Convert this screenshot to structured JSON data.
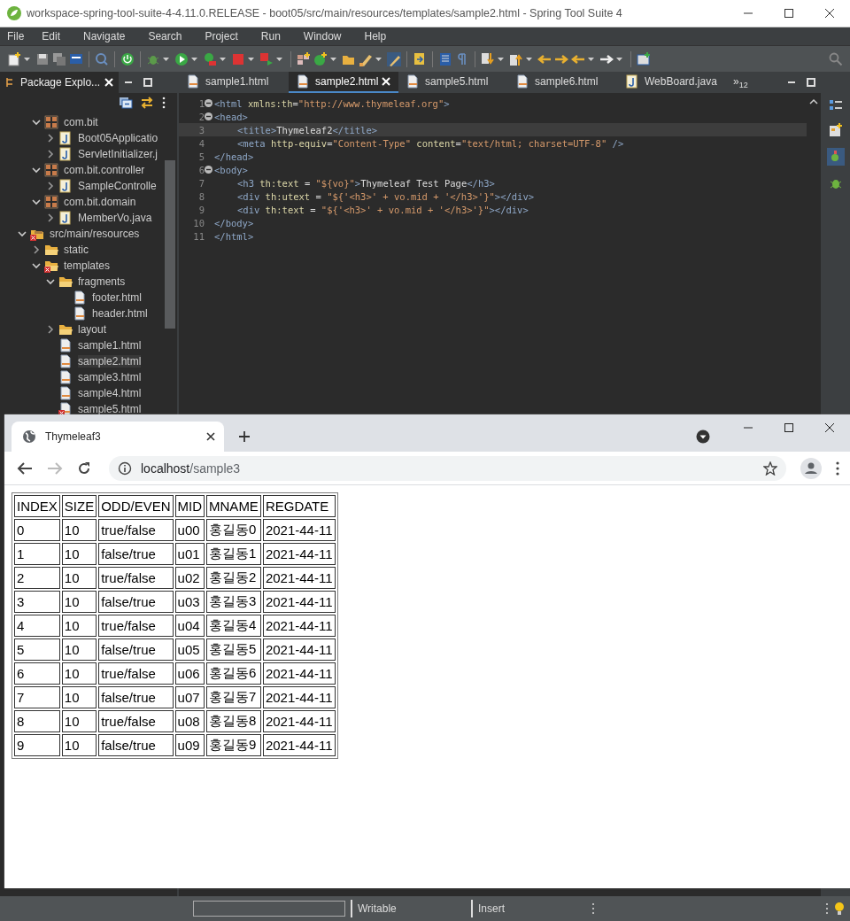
{
  "window": {
    "title": "workspace-spring-tool-suite-4-4.11.0.RELEASE - boot05/src/main/resources/templates/sample2.html - Spring Tool Suite 4"
  },
  "menu": [
    "File",
    "Edit",
    "Navigate",
    "Search",
    "Project",
    "Run",
    "Window",
    "Help"
  ],
  "explorer": {
    "tab": "Package Explo...",
    "upper_items": [
      {
        "label": "com.bit",
        "kind": "package",
        "expanded": true,
        "children": [
          {
            "label": "Boot05Applicatio",
            "kind": "java",
            "expanded": false
          },
          {
            "label": "ServletInitializer.j",
            "kind": "java",
            "expanded": false
          }
        ]
      },
      {
        "label": "com.bit.controller",
        "kind": "package",
        "expanded": true,
        "children": [
          {
            "label": "SampleControlle",
            "kind": "java",
            "expanded": false
          }
        ]
      },
      {
        "label": "com.bit.domain",
        "kind": "package",
        "expanded": true,
        "children": [
          {
            "label": "MemberVo.java",
            "kind": "java",
            "expanded": false
          }
        ]
      }
    ],
    "items": [
      {
        "label": "src/main/resources",
        "kind": "source-folder",
        "expanded": true,
        "error": true,
        "children": [
          {
            "label": "static",
            "kind": "folder",
            "expanded": false,
            "error": false
          },
          {
            "label": "templates",
            "kind": "folder",
            "expanded": true,
            "error": true,
            "children": [
              {
                "label": "fragments",
                "kind": "folder",
                "expanded": true,
                "error": false,
                "children": [
                  {
                    "label": "footer.html",
                    "kind": "html",
                    "error": false,
                    "selected": false
                  },
                  {
                    "label": "header.html",
                    "kind": "html",
                    "error": false,
                    "selected": false
                  }
                ]
              },
              {
                "label": "layout",
                "kind": "folder",
                "expanded": false,
                "error": false
              },
              {
                "label": "sample1.html",
                "kind": "html",
                "error": false,
                "selected": false
              },
              {
                "label": "sample2.html",
                "kind": "html",
                "error": false,
                "selected": true
              },
              {
                "label": "sample3.html",
                "kind": "html",
                "error": false,
                "selected": false
              },
              {
                "label": "sample4.html",
                "kind": "html",
                "error": false,
                "selected": false
              },
              {
                "label": "sample5.html",
                "kind": "html",
                "error": true,
                "selected": false
              }
            ]
          }
        ]
      }
    ]
  },
  "editor": {
    "tabs": [
      {
        "label": "sample1.html",
        "kind": "html",
        "selected": false
      },
      {
        "label": "sample2.html",
        "kind": "html",
        "selected": true
      },
      {
        "label": "sample5.html",
        "kind": "html",
        "selected": false
      },
      {
        "label": "sample6.html",
        "kind": "html",
        "selected": false
      },
      {
        "label": "WebBoard.java",
        "kind": "java",
        "selected": false
      }
    ],
    "overflow": "»$_{12}$",
    "lines": [
      {
        "number": "1",
        "foldable": true,
        "current": false,
        "indented": false,
        "tokens": [
          {
            "kind": "tag",
            "text": "<html "
          },
          {
            "kind": "attr",
            "text": "xmlns:th"
          },
          {
            "kind": "text",
            "text": "="
          },
          {
            "kind": "str",
            "text": "\"http://www.thymeleaf.org\""
          },
          {
            "kind": "tag",
            "text": ">"
          }
        ]
      },
      {
        "number": "2",
        "foldable": true,
        "current": false,
        "indented": false,
        "tokens": [
          {
            "kind": "tag",
            "text": "<head>"
          }
        ]
      },
      {
        "number": "3",
        "foldable": false,
        "current": true,
        "indented": true,
        "tokens": [
          {
            "kind": "tag",
            "text": "<title>"
          },
          {
            "kind": "text",
            "text": "Thymeleaf2"
          },
          {
            "kind": "tag",
            "text": "</title>"
          }
        ]
      },
      {
        "number": "4",
        "foldable": false,
        "current": false,
        "indented": true,
        "tokens": [
          {
            "kind": "tag",
            "text": "<meta "
          },
          {
            "kind": "attr",
            "text": "http-equiv"
          },
          {
            "kind": "text",
            "text": "="
          },
          {
            "kind": "str",
            "text": "\"Content-Type\""
          },
          {
            "kind": "attr",
            "text": " content"
          },
          {
            "kind": "text",
            "text": "="
          },
          {
            "kind": "str",
            "text": "\"text/html; charset=UTF-8\""
          },
          {
            "kind": "tag",
            "text": " />"
          }
        ]
      },
      {
        "number": "5",
        "foldable": false,
        "current": false,
        "indented": false,
        "tokens": [
          {
            "kind": "tag",
            "text": "</head>"
          }
        ]
      },
      {
        "number": "6",
        "foldable": true,
        "current": false,
        "indented": false,
        "tokens": [
          {
            "kind": "tag",
            "text": "<body>"
          }
        ]
      },
      {
        "number": "7",
        "foldable": false,
        "current": false,
        "indented": true,
        "tokens": [
          {
            "kind": "tag",
            "text": "<h3 "
          },
          {
            "kind": "attr",
            "text": "th:text"
          },
          {
            "kind": "text",
            "text": " = "
          },
          {
            "kind": "str",
            "text": "\"${vo}\""
          },
          {
            "kind": "tag",
            "text": ">"
          },
          {
            "kind": "text",
            "text": "Thymeleaf Test Page"
          },
          {
            "kind": "tag",
            "text": "</h3>"
          }
        ]
      },
      {
        "number": "8",
        "foldable": false,
        "current": false,
        "indented": true,
        "tokens": [
          {
            "kind": "tag",
            "text": "<div "
          },
          {
            "kind": "attr",
            "text": "th:utext"
          },
          {
            "kind": "text",
            "text": " = "
          },
          {
            "kind": "str",
            "text": "\"${'<h3>' + vo.mid + '</h3>'}\""
          },
          {
            "kind": "tag",
            "text": "></div>"
          }
        ]
      },
      {
        "number": "9",
        "foldable": false,
        "current": false,
        "indented": true,
        "tokens": [
          {
            "kind": "tag",
            "text": "<div "
          },
          {
            "kind": "attr",
            "text": "th:text"
          },
          {
            "kind": "text",
            "text": " = "
          },
          {
            "kind": "str",
            "text": "\"${'<h3>' + vo.mid + '</h3>'}\""
          },
          {
            "kind": "tag",
            "text": "></div>"
          }
        ]
      },
      {
        "number": "10",
        "foldable": false,
        "current": false,
        "indented": false,
        "tokens": [
          {
            "kind": "tag",
            "text": "</body>"
          }
        ]
      },
      {
        "number": "11",
        "foldable": false,
        "current": false,
        "indented": false,
        "tokens": [
          {
            "kind": "tag",
            "text": "</html>"
          }
        ]
      }
    ]
  },
  "browser": {
    "tab_title": "Thymeleaf3",
    "url_host": "localhost",
    "url_path": "/sample3",
    "table": {
      "columns": [
        "INDEX",
        "SIZE",
        "ODD/EVEN",
        "MID",
        "MNAME",
        "REGDATE"
      ],
      "rows": [
        [
          "0",
          "10",
          "true/false",
          "u00",
          "홍길동0",
          "2021-44-11"
        ],
        [
          "1",
          "10",
          "false/true",
          "u01",
          "홍길동1",
          "2021-44-11"
        ],
        [
          "2",
          "10",
          "true/false",
          "u02",
          "홍길동2",
          "2021-44-11"
        ],
        [
          "3",
          "10",
          "false/true",
          "u03",
          "홍길동3",
          "2021-44-11"
        ],
        [
          "4",
          "10",
          "true/false",
          "u04",
          "홍길동4",
          "2021-44-11"
        ],
        [
          "5",
          "10",
          "false/true",
          "u05",
          "홍길동5",
          "2021-44-11"
        ],
        [
          "6",
          "10",
          "true/false",
          "u06",
          "홍길동6",
          "2021-44-11"
        ],
        [
          "7",
          "10",
          "false/true",
          "u07",
          "홍길동7",
          "2021-44-11"
        ],
        [
          "8",
          "10",
          "true/false",
          "u08",
          "홍길동8",
          "2021-44-11"
        ],
        [
          "9",
          "10",
          "false/true",
          "u09",
          "홍길동9",
          "2021-44-11"
        ]
      ]
    }
  },
  "status_bar": {
    "mode": "Writable",
    "insert": "Insert"
  }
}
